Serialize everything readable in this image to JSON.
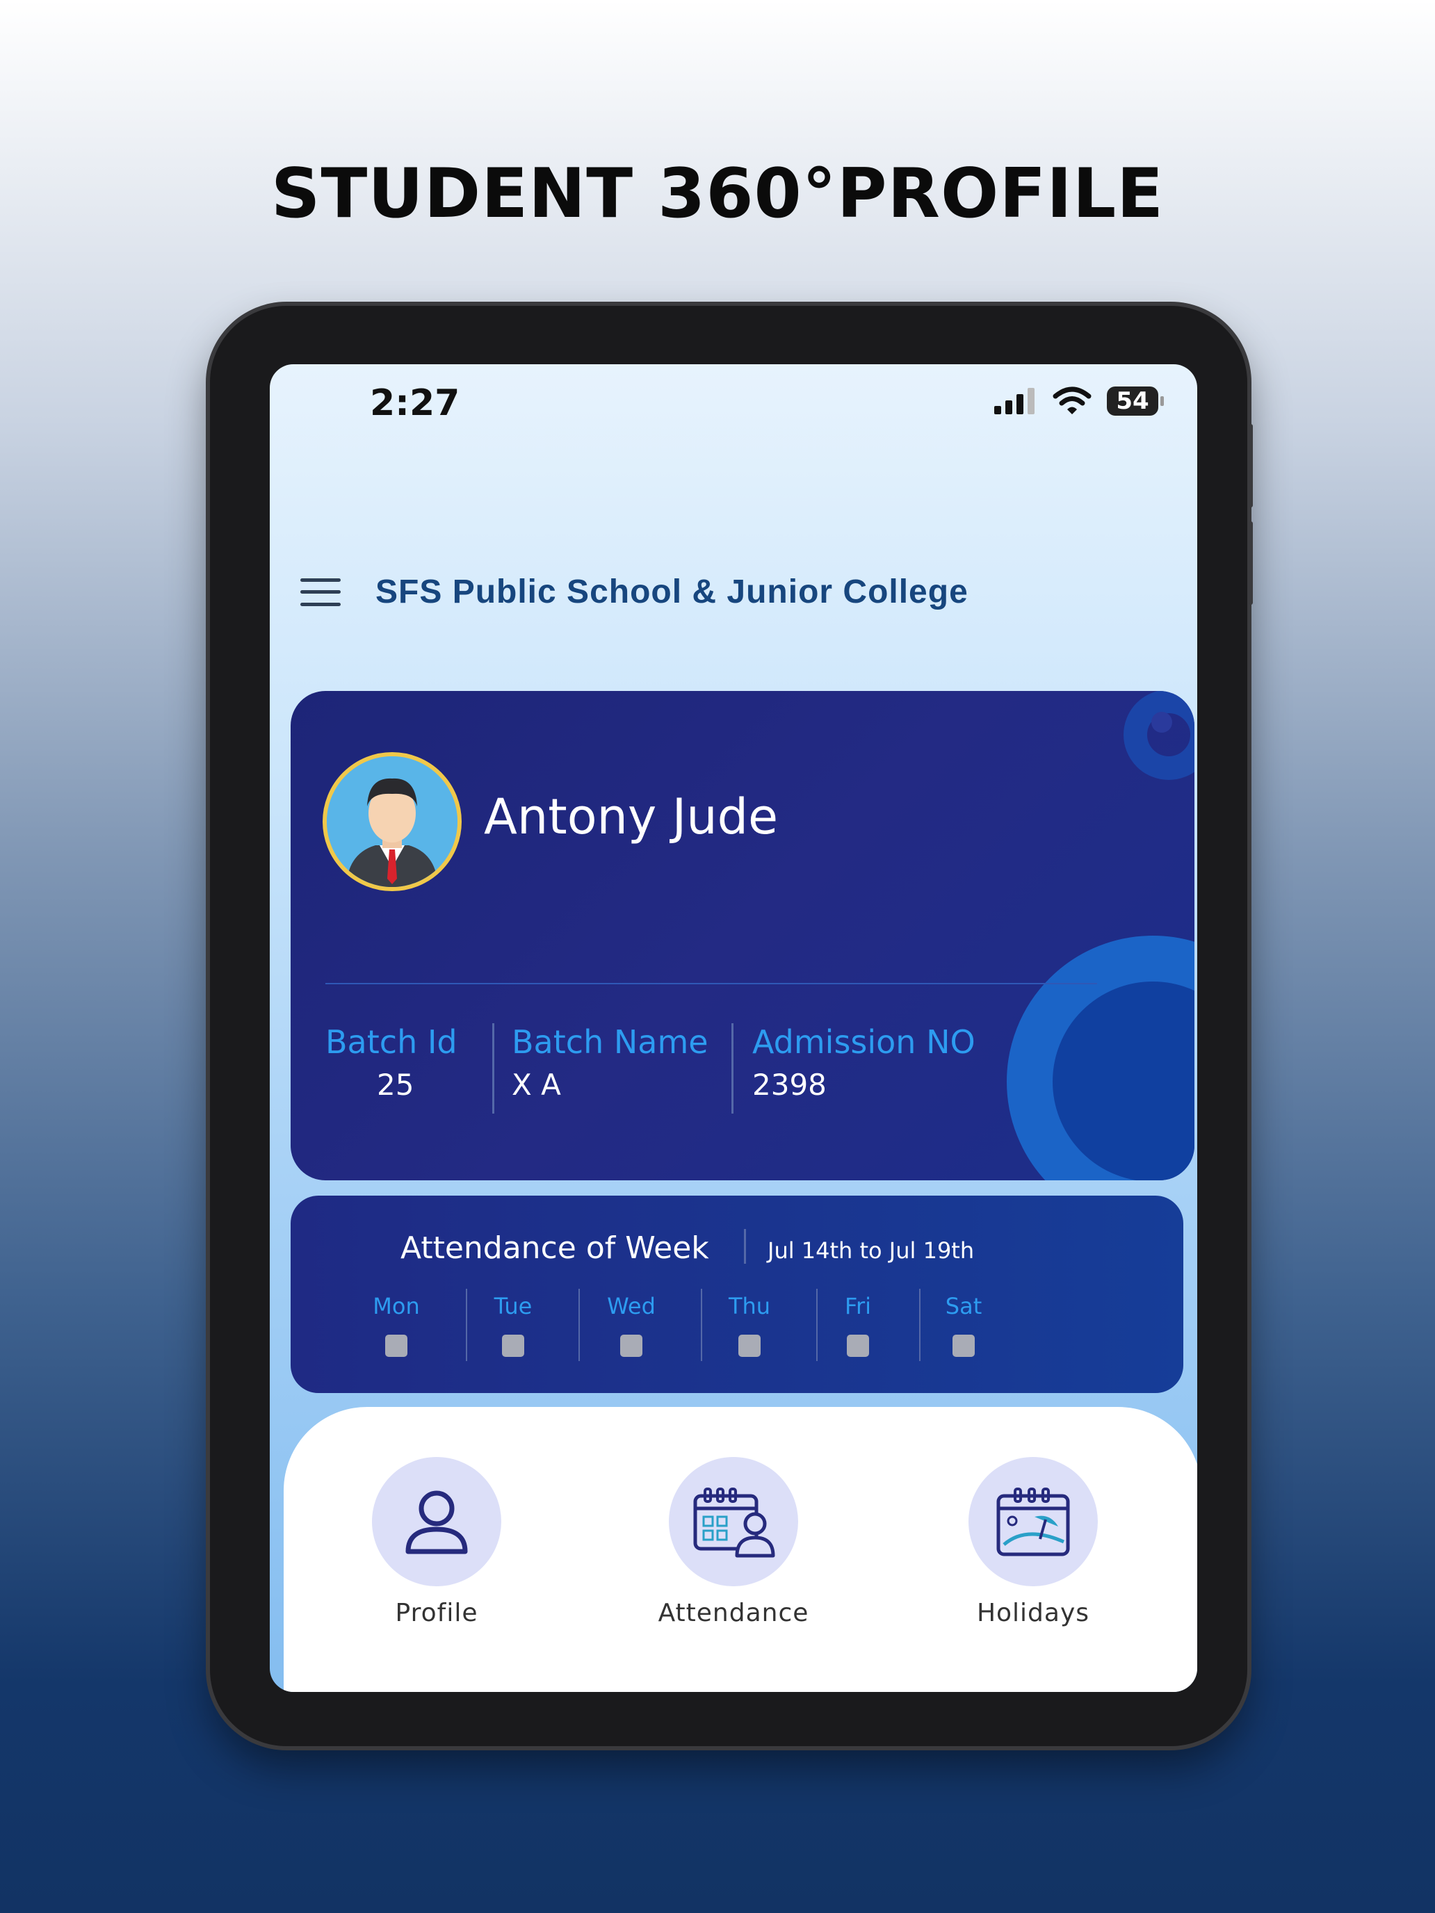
{
  "headline": "STUDENT 360°PROFILE",
  "status_bar": {
    "time": "2:27",
    "battery": "54"
  },
  "app": {
    "title": "SFS Public School & Junior College"
  },
  "student": {
    "name": "Antony Jude",
    "batch_id_label": "Batch Id",
    "batch_id": "25",
    "batch_name_label": "Batch Name",
    "batch_name": "X A",
    "admission_label": "Admission NO",
    "admission_no": "2398"
  },
  "attendance": {
    "title": "Attendance of Week",
    "range": "Jul 14th to Jul 19th",
    "days": [
      "Mon",
      "Tue",
      "Wed",
      "Thu",
      "Fri",
      "Sat"
    ]
  },
  "nav": [
    {
      "label": "Profile",
      "icon": "user-icon"
    },
    {
      "label": "Attendance",
      "icon": "calendar-user-icon"
    },
    {
      "label": "Holidays",
      "icon": "calendar-beach-icon"
    }
  ],
  "colors": {
    "accent": "#2d9cf0",
    "card": "#1d2578",
    "title": "#17467e",
    "nav_circle": "#dcdff8"
  }
}
